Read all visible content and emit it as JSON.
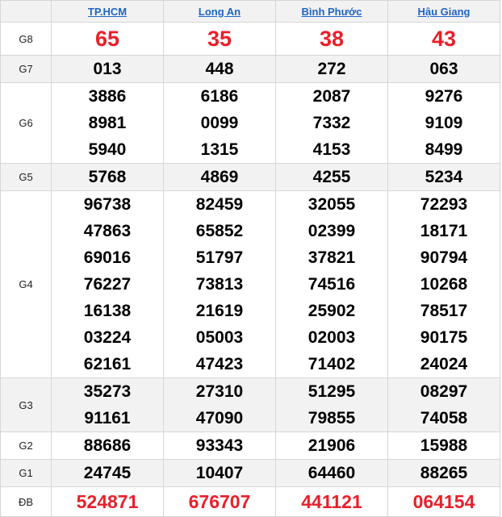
{
  "provinces": [
    "TP.HCM",
    "Long An",
    "Bình Phước",
    "Hậu Giang"
  ],
  "prizes": [
    {
      "label": "G8",
      "values": [
        [
          "65"
        ],
        [
          "35"
        ],
        [
          "38"
        ],
        [
          "43"
        ]
      ]
    },
    {
      "label": "G7",
      "values": [
        [
          "013"
        ],
        [
          "448"
        ],
        [
          "272"
        ],
        [
          "063"
        ]
      ]
    },
    {
      "label": "G6",
      "values": [
        [
          "3886",
          "8981",
          "5940"
        ],
        [
          "6186",
          "0099",
          "1315"
        ],
        [
          "2087",
          "7332",
          "4153"
        ],
        [
          "9276",
          "9109",
          "8499"
        ]
      ]
    },
    {
      "label": "G5",
      "values": [
        [
          "5768"
        ],
        [
          "4869"
        ],
        [
          "4255"
        ],
        [
          "5234"
        ]
      ]
    },
    {
      "label": "G4",
      "values": [
        [
          "96738",
          "47863",
          "69016",
          "76227",
          "16138",
          "03224",
          "62161"
        ],
        [
          "82459",
          "65852",
          "51797",
          "73813",
          "21619",
          "05003",
          "47423"
        ],
        [
          "32055",
          "02399",
          "37821",
          "74516",
          "25902",
          "02003",
          "71402"
        ],
        [
          "72293",
          "18171",
          "90794",
          "10268",
          "78517",
          "90175",
          "24024"
        ]
      ]
    },
    {
      "label": "G3",
      "values": [
        [
          "35273",
          "91161"
        ],
        [
          "27310",
          "47090"
        ],
        [
          "51295",
          "79855"
        ],
        [
          "08297",
          "74058"
        ]
      ]
    },
    {
      "label": "G2",
      "values": [
        [
          "88686"
        ],
        [
          "93343"
        ],
        [
          "21906"
        ],
        [
          "15988"
        ]
      ]
    },
    {
      "label": "G1",
      "values": [
        [
          "24745"
        ],
        [
          "10407"
        ],
        [
          "64460"
        ],
        [
          "88265"
        ]
      ]
    },
    {
      "label": "ĐB",
      "values": [
        [
          "524871"
        ],
        [
          "676707"
        ],
        [
          "441121"
        ],
        [
          "064154"
        ]
      ]
    }
  ],
  "colors": {
    "highlight": "#e8202a",
    "link": "#1f64c6",
    "shade": "#f2f2f2"
  }
}
